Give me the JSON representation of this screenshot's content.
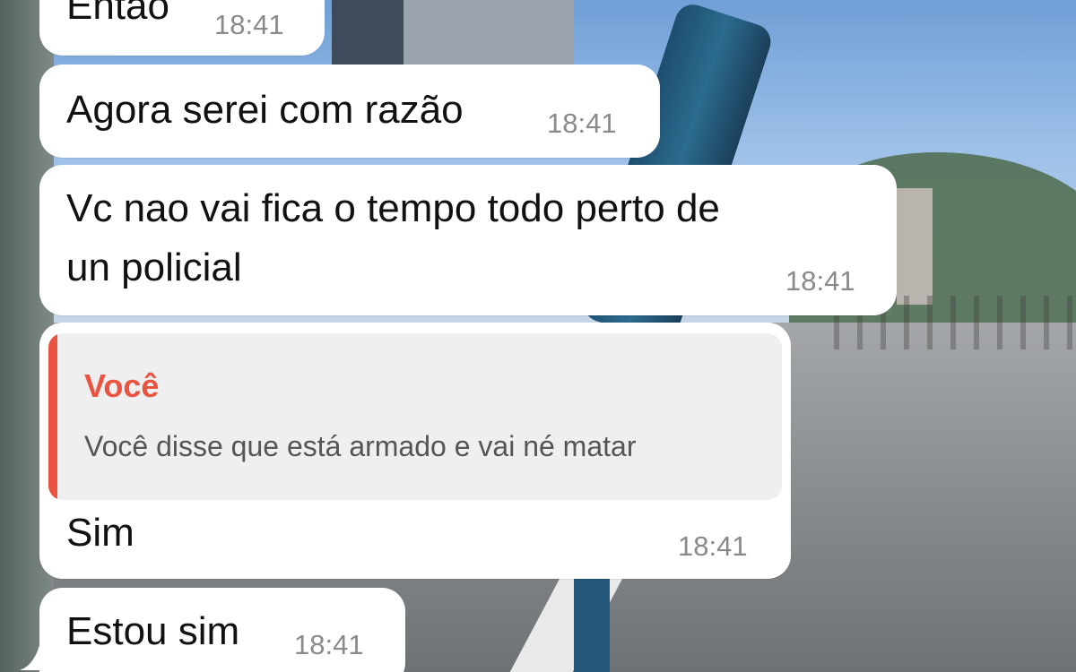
{
  "messages": [
    {
      "text": "Então",
      "time": "18:41"
    },
    {
      "text": "Agora serei com razão",
      "time": "18:41"
    },
    {
      "text_line1": "Vc nao vai fica o tempo todo perto de",
      "text_line2": "un policial",
      "time": "18:41"
    },
    {
      "quote_author": "Você",
      "quote_text": "Você disse que está armado e vai né matar",
      "text": "Sim",
      "time": "18:41"
    },
    {
      "text": "Estou sim",
      "time": "18:41"
    }
  ],
  "colors": {
    "bubble": "#ffffff",
    "quote_accent": "#e9533f",
    "time": "#8a8a8a"
  }
}
